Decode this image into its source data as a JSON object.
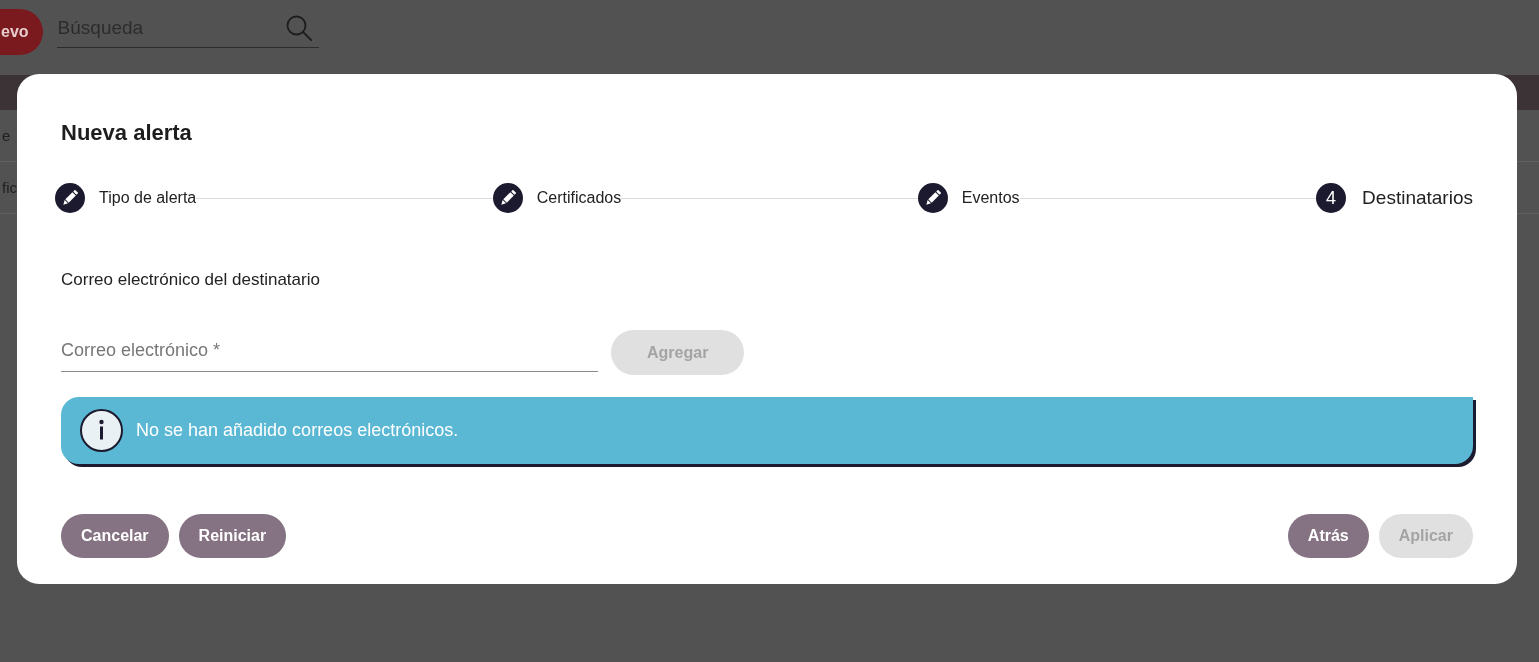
{
  "background_page": {
    "new_button": {
      "label": "evo"
    },
    "search": {
      "placeholder": "Búsqueda"
    },
    "rows": [
      "e",
      "fic"
    ]
  },
  "dialog": {
    "title": "Nueva alerta",
    "steps": [
      {
        "label": "Tipo de alerta",
        "completed": true,
        "selected": false
      },
      {
        "label": "Certificados",
        "completed": true,
        "selected": false
      },
      {
        "label": "Eventos",
        "completed": true,
        "selected": false
      },
      {
        "label": "Destinatarios",
        "number": "4",
        "completed": false,
        "selected": true
      }
    ],
    "section_label": "Correo electrónico del destinatario",
    "email_field": {
      "placeholder": "Correo electrónico *"
    },
    "add_button": {
      "label": "Agregar",
      "disabled": true
    },
    "notice": {
      "kind": "info",
      "message": "No se han añadido correos electrónicos."
    },
    "footer_left": [
      {
        "label": "Cancelar",
        "disabled": false
      },
      {
        "label": "Reiniciar",
        "disabled": false
      }
    ],
    "footer_right": [
      {
        "label": "Atrás",
        "disabled": false
      },
      {
        "label": "Aplicar",
        "disabled": true
      }
    ]
  }
}
